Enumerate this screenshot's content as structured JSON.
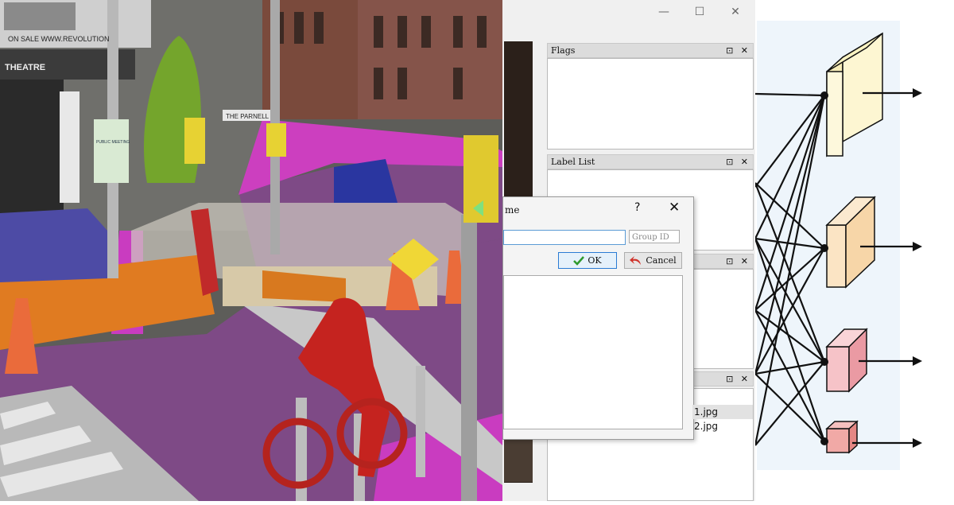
{
  "photo": {
    "billboard_text": "ON SALE WWW.REVOLUTION",
    "theatre_sign": "THEATRE",
    "shop_sign": "THE PARNELL",
    "poster_text": "PUBLIC MEETING"
  },
  "app": {
    "window_controls": {
      "minimize": "—",
      "maximize": "☐",
      "close": "✕"
    },
    "docks": {
      "flags": {
        "title": "Flags"
      },
      "label_list": {
        "title": "Label List"
      },
      "polygon_labels": {
        "title": ""
      },
      "file_list": {
        "title": ""
      },
      "dock_controls": "⊡ ✕"
    },
    "dialog": {
      "title_fragment": "me",
      "help": "?",
      "close": "✕",
      "name_value": "",
      "group_id_placeholder": "Group ID",
      "ok_label": "OK",
      "cancel_label": "Cancel"
    },
    "files": [
      "1.jpg",
      "2.jpg"
    ]
  },
  "diagram": {
    "accent_line": "#111111",
    "blocks": [
      {
        "name": "block-1",
        "color": "#fdf6d2"
      },
      {
        "name": "block-2",
        "color": "#fbe4c4"
      },
      {
        "name": "block-3",
        "color": "#f6c3c8"
      },
      {
        "name": "block-4",
        "color": "#f1a9a6"
      }
    ]
  }
}
